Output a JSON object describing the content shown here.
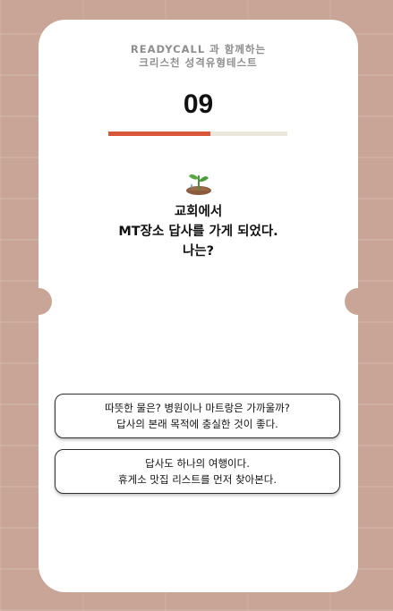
{
  "brand": {
    "line1": "READYCALL 과 함께하는",
    "line2": "크리스천 성격유형테스트"
  },
  "question": {
    "number": "09",
    "progress": 0.57,
    "icon": "sprout-icon",
    "lines": [
      "교회에서",
      "MT장소 답사를 가게 되었다.",
      "나는?"
    ]
  },
  "options": [
    {
      "line1": "따뜻한 물은? 병원이나 마트랑은 가까울까?",
      "line2": "답사의 본래 목적에 충실한 것이 좋다."
    },
    {
      "line1": "답사도 하나의 여행이다.",
      "line2": "휴게소 맛집 리스트를 먼저 찾아본다."
    }
  ],
  "colors": {
    "background": "#c8a596",
    "progress_fill": "#d9563a",
    "progress_track": "#ece7da",
    "card": "#ffffff"
  }
}
